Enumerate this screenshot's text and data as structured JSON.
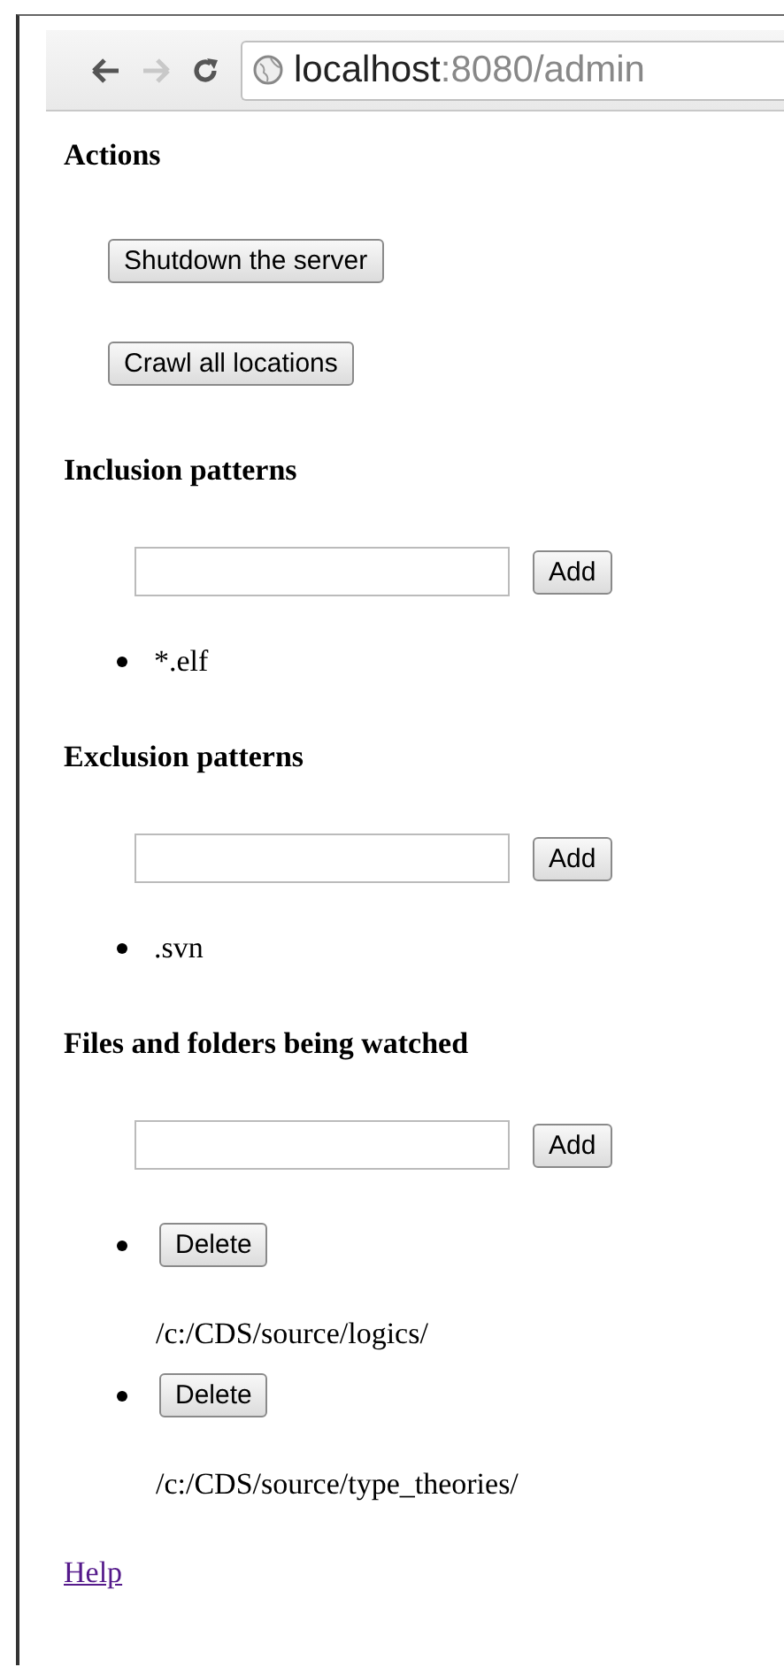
{
  "browser": {
    "url_host": "localhost",
    "url_rest": ":8080/admin",
    "back_enabled": true,
    "forward_enabled": false
  },
  "actions": {
    "heading": "Actions",
    "buttons": [
      "Shutdown the server",
      "Crawl all locations"
    ]
  },
  "sections": [
    {
      "heading": "Inclusion patterns",
      "add_button": "Add",
      "items": [
        {
          "kind": "text",
          "text": "*.elf"
        }
      ]
    },
    {
      "heading": "Exclusion patterns",
      "add_button": "Add",
      "items": [
        {
          "kind": "text",
          "text": ".svn"
        }
      ]
    },
    {
      "heading": "Files and folders being watched",
      "add_button": "Add",
      "items": [
        {
          "kind": "deletable",
          "button": "Delete",
          "text": "/c:/CDS/source/logics/"
        },
        {
          "kind": "deletable",
          "button": "Delete",
          "text": "/c:/CDS/source/type_theories/"
        }
      ]
    }
  ],
  "help_link": "Help"
}
